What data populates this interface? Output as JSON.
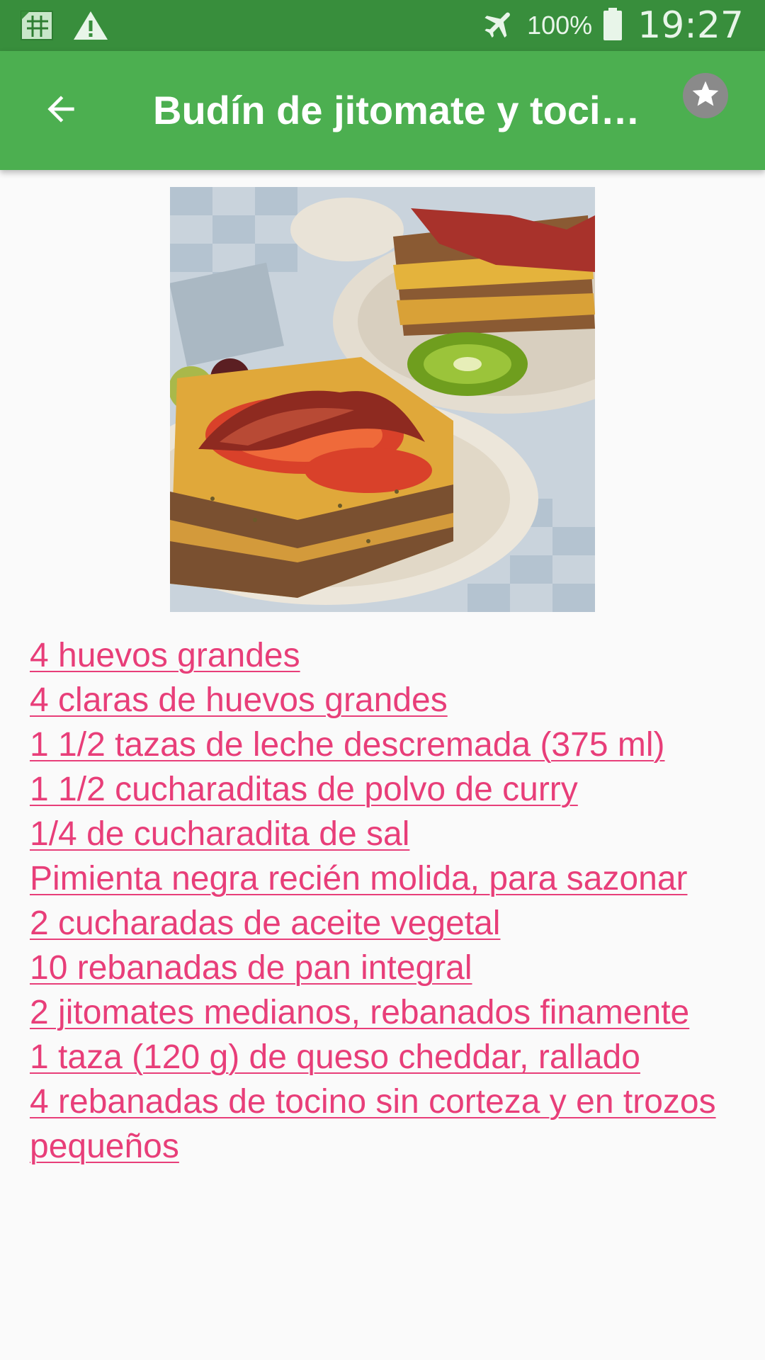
{
  "status_bar": {
    "icons": [
      "sim-card-icon",
      "warning-icon",
      "airplane-icon",
      "battery-icon"
    ],
    "battery": "100%",
    "time": "19:27"
  },
  "app_bar": {
    "back_icon": "arrow-back-icon",
    "title": "Budín de jitomate y tocino",
    "favorite_icon": "star-icon"
  },
  "recipe": {
    "image_subject": "tomato bacon bread pudding on a plate with kiwi",
    "ingredients": [
      "4 huevos grandes",
      "4 claras de huevos grandes",
      "1 1/2 tazas de leche descremada (375 ml)",
      "1 1/2 cucharaditas de polvo de curry",
      "1/4 de cucharadita de sal",
      "Pimienta negra recién molida, para sazonar",
      "2 cucharadas de aceite vegetal",
      "10 rebanadas de pan integral",
      "2 jitomates medianos, rebanados finamente",
      "1 taza (120 g) de queso cheddar, rallado",
      "4 rebanadas de tocino sin corteza y en trozos pequeños"
    ]
  },
  "colors": {
    "status_bar": "#388e3c",
    "app_bar": "#4caf50",
    "link": "#e83e79",
    "background": "#fafafa"
  }
}
